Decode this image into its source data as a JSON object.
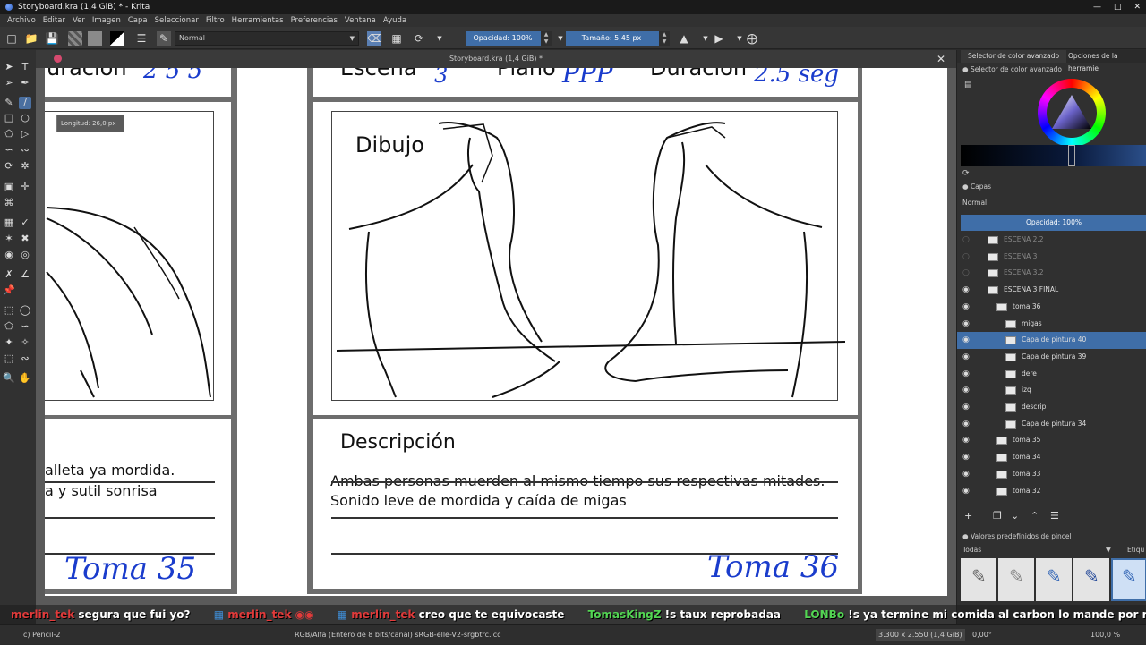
{
  "window": {
    "title": "Storyboard.kra (1,4 GiB) * - Krita"
  },
  "menu": [
    "Archivo",
    "Editar",
    "Ver",
    "Imagen",
    "Capa",
    "Seleccionar",
    "Filtro",
    "Herramientas",
    "Preferencias",
    "Ventana",
    "Ayuda"
  ],
  "toolbar": {
    "blend_mode": "Normal",
    "opacity_label": "Opacidad: 100%",
    "size_label": "Tamaño: 5,45 px"
  },
  "document": {
    "tab_title": "Storyboard.kra (1,4 GiB) *",
    "tooltip": "Longitud: 26,0 px",
    "left_panel": {
      "header_partial": "uración",
      "handwritten_number_partial": "2 5 5",
      "description_line1": "alleta ya mordida.",
      "description_line2": "a y sutil sonrisa",
      "take_label": "Toma 35"
    },
    "right_panel": {
      "header_scene": "Escena",
      "header_scene_value": "3",
      "header_shot": "Plano",
      "header_shot_value": "PPP",
      "header_duration": "Duración",
      "header_duration_value": "2.5 seg",
      "drawing_label": "Dibujo",
      "description_title": "Descripción",
      "description_line1": "Ambas personas muerden al mismo tiempo sus respectivas mitades.",
      "description_line2": "Sonido leve de mordida y caída de migas",
      "take_label": "Toma 36"
    }
  },
  "right_panel": {
    "tabs": [
      "Selector de color avanzado",
      "Opciones de la herramie"
    ],
    "color_selector_title": "Selector de color avanzado",
    "layers_title": "Capas",
    "layers_blend": "Normal",
    "layers_opacity": "Opacidad:  100%",
    "layers": [
      {
        "name": "ESCENA 2.2",
        "visible": false,
        "indent": 1
      },
      {
        "name": "ESCENA 3",
        "visible": false,
        "indent": 1
      },
      {
        "name": "ESCENA 3.2",
        "visible": false,
        "indent": 1
      },
      {
        "name": "ESCENA 3 FINAL",
        "visible": true,
        "indent": 1
      },
      {
        "name": "toma 36",
        "visible": true,
        "indent": 2
      },
      {
        "name": "migas",
        "visible": true,
        "indent": 3
      },
      {
        "name": "Capa de pintura 40",
        "visible": true,
        "indent": 3,
        "selected": true
      },
      {
        "name": "Capa de pintura 39",
        "visible": true,
        "indent": 3
      },
      {
        "name": "dere",
        "visible": true,
        "indent": 3
      },
      {
        "name": "izq",
        "visible": true,
        "indent": 3
      },
      {
        "name": "descrip",
        "visible": true,
        "indent": 3
      },
      {
        "name": "Capa de pintura 34",
        "visible": true,
        "indent": 3
      },
      {
        "name": "toma 35",
        "visible": true,
        "indent": 2
      },
      {
        "name": "toma 34",
        "visible": true,
        "indent": 2
      },
      {
        "name": "toma 33",
        "visible": true,
        "indent": 2
      },
      {
        "name": "toma 32",
        "visible": true,
        "indent": 2
      }
    ],
    "brush_presets_title": "Valores predefinidos de pincel",
    "brush_filter": "Todas",
    "brush_tag_partial": "Etiqu"
  },
  "chat": [
    {
      "user": "merlin_tek",
      "message": "segura que fui yo?"
    },
    {
      "user": "merlin_tek",
      "message": ""
    },
    {
      "user": "merlin_tek",
      "message": "creo que te equivocaste"
    },
    {
      "user": "TomasKingZ",
      "message": "!s taux reprobadaa"
    },
    {
      "user": "LONBo",
      "message": "!s ya termine mi comida al carbon lo mande por random"
    }
  ],
  "colors": {
    "accent": "#3f6ea8",
    "handwriting": "#1a3ccc",
    "chat_user_red": "#e23a3a",
    "chat_user_green": "#53d653"
  },
  "status": {
    "brush": "c) Pencil-2",
    "color_space": "RGB/Alfa (Entero de 8 bits/canal)  sRGB-elle-V2-srgbtrc.icc",
    "dimensions": "3.300 x 2.550 (1,4 GiB)",
    "rotation": "0,00°",
    "zoom": "100,0 %"
  }
}
